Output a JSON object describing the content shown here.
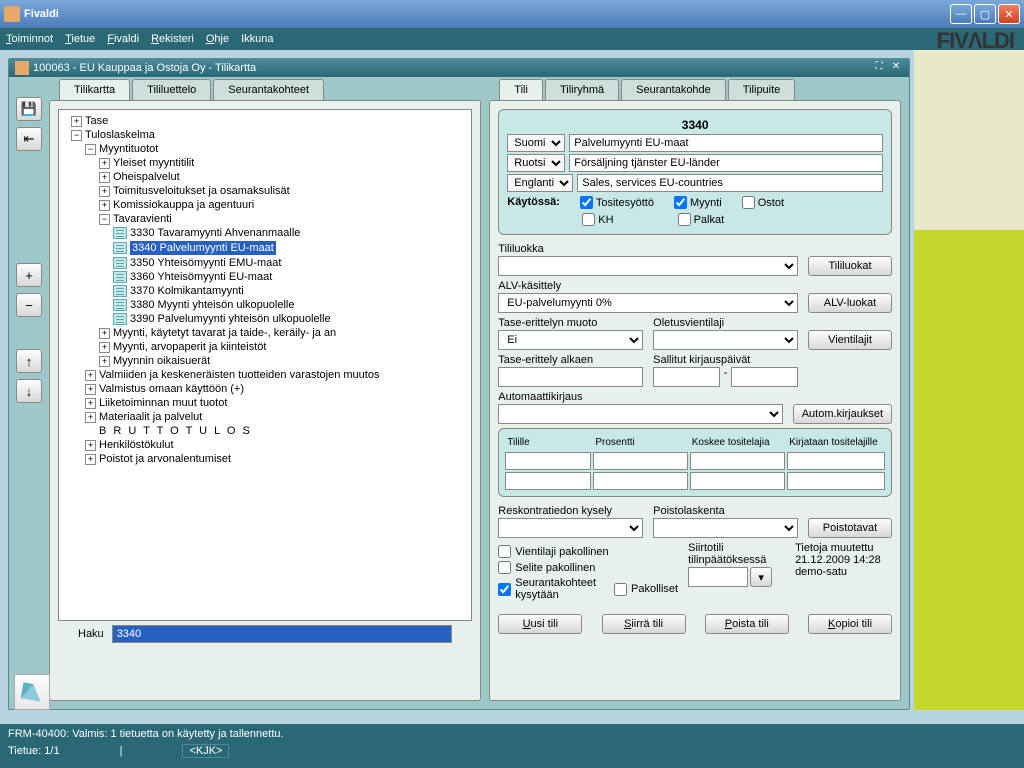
{
  "window": {
    "title": "Fivaldi"
  },
  "brand": "FIVΛLDI",
  "menu": {
    "toiminnot": "Toiminnot",
    "tietue": "Tietue",
    "fivaldi": "Fivaldi",
    "rekisteri": "Rekisteri",
    "ohje": "Ohje",
    "ikkuna": "Ikkuna"
  },
  "subwin": {
    "title": "100063 - EU Kauppaa ja Ostoja Oy - Tilikartta"
  },
  "left_tabs": {
    "tilikartta": "Tilikartta",
    "tililuettelo": "Tililuettelo",
    "seurantakohteet": "Seurantakohteet"
  },
  "right_tabs": {
    "tili": "Tili",
    "tiliryhma": "Tiliryhmä",
    "seurantakohde": "Seurantakohde",
    "tilipuite": "Tilipuite"
  },
  "tree": {
    "tase": "Tase",
    "tulos": "Tuloslaskelma",
    "myyntituotot": "Myyntituotot",
    "yleiset": "Yleiset myyntitilit",
    "oheis": "Oheispalvelut",
    "toimitus": "Toimitusveloitukset ja osamaksulisät",
    "komissio": "Komissiokauppa ja agentuuri",
    "tavaravienti": "Tavaravienti",
    "a3330": "3330 Tavaramyynti Ahvenanmaalle",
    "a3340": "3340 Palvelumyynti EU-maat",
    "a3350": "3350 Yhteisömyynti EMU-maat",
    "a3360": "3360 Yhteisömyynti EU-maat",
    "a3370": "3370 Kolmikantamyynti",
    "a3380": "3380 Myynti yhteisön ulkopuolelle",
    "a3390": "3390 Palvelumyynti yhteisön ulkopuolelle",
    "myynti_kayt": "Myynti, käytetyt tavarat ja taide-, keräily- ja an",
    "myynti_arvo": "Myynti, arvopaperit ja kiinteistöt",
    "myynnin_oik": "Myynnin oikaisuerät",
    "valmiiden": "Valmiiden ja keskeneräisten tuotteiden varastojen muutos",
    "valmistus": "Valmistus omaan käyttöön (+)",
    "liiketoim": "Liiketoiminnan muut tuotot",
    "materiaalit": "Materiaalit ja palvelut",
    "brutto": "B R U T T O T U L O S",
    "henkilosto": "Henkilöstökulut",
    "poistot": "Poistot ja arvonalentumiset"
  },
  "haku": {
    "label": "Haku",
    "value": "3340"
  },
  "account": {
    "number": "3340",
    "lang_suomi": "Suomi",
    "name_fi": "Palvelumyynti EU-maat",
    "lang_ruotsi": "Ruotsi",
    "name_sv": "Försäljning tjänster EU-länder",
    "lang_en": "Englanti",
    "name_en": "Sales, services EU-countries",
    "kaytossa_lbl": "Käytössä:",
    "cb_tosite": "Tositesyöttö",
    "cb_myynti": "Myynti",
    "cb_ostot": "Ostot",
    "cb_kh": "KH",
    "cb_palkat": "Palkat"
  },
  "fields": {
    "tililuokka": "Tililuokka",
    "btn_tililuokat": "Tililuokat",
    "alv": "ALV-käsittely",
    "alv_val": "EU-palvelumyynti 0%",
    "btn_alv": "ALV-luokat",
    "tase_muoto": "Tase-erittelyn muoto",
    "tase_muoto_val": "Ei",
    "oletus": "Oletusvientilaji",
    "btn_vientilajit": "Vientilajit",
    "tase_alkaen": "Tase-erittely alkaen",
    "sallitut": "Sallitut kirjauspäivät",
    "autokirj": "Automaattikirjaus",
    "btn_autokirj": "Autom.kirjaukset",
    "tilille": "Tilille",
    "prosentti": "Prosentti",
    "koskee": "Koskee tositelajia",
    "kirjataan": "Kirjataan tositelajille",
    "reskontra": "Reskontratiedon kysely",
    "poistolask": "Poistolaskenta",
    "btn_poistot": "Poistotavat",
    "vientilaji_pak": "Vientilaji pakollinen",
    "selite_pak": "Selite pakollinen",
    "siirto": "Siirtotili tilinpäätöksessä",
    "seurantak": "Seurantakohteet kysytään",
    "pakolliset": "Pakolliset",
    "tietoja": "Tietoja muutettu",
    "muutettu_ts": "21.12.2009 14:28",
    "muutettu_user": "demo-satu"
  },
  "buttons": {
    "uusi": "Uusi tili",
    "siirra": "Siirrä tili",
    "poista": "Poista tili",
    "kopioi": "Kopioi tili"
  },
  "footer": {
    "msg": "FRM-40400: Valmis: 1 tietuetta on käytetty ja tallennettu.",
    "tietue": "Tietue: 1/1",
    "kjk": "<KJK>"
  }
}
